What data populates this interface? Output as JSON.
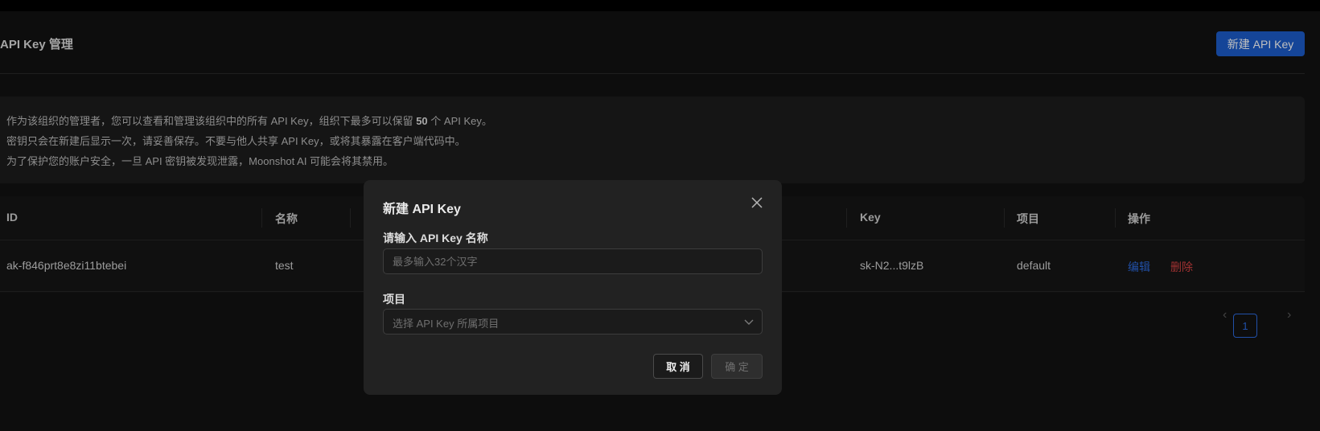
{
  "page": {
    "title": "API Key 管理",
    "new_button": "新建 API Key"
  },
  "notice": {
    "line1_pre": "作为该组织的管理者，您可以查看和管理该组织中的所有 API Key，组织下最多可以保留 ",
    "line1_count": "50",
    "line1_post": " 个 API Key。",
    "line2": "密钥只会在新建后显示一次，请妥善保存。不要与他人共享 API Key，或将其暴露在客户端代码中。",
    "line3": "为了保护您的账户安全，一旦 API 密钥被发现泄露，Moonshot AI 可能会将其禁用。"
  },
  "table": {
    "headers": {
      "id": "ID",
      "name": "名称",
      "key": "Key",
      "project": "项目",
      "actions": "操作"
    },
    "rows": [
      {
        "id": "ak-f846prt8e8zi11btebei",
        "name": "test",
        "key": "sk-N2...t9lzB",
        "project": "default",
        "edit": "编辑",
        "delete": "删除"
      }
    ]
  },
  "pagination": {
    "current_page": "1",
    "prev": "‹",
    "next": "›"
  },
  "modal": {
    "title": "新建 API Key",
    "name_label": "请输入 API Key 名称",
    "name_placeholder": "最多输入32个汉字",
    "project_label": "项目",
    "project_placeholder": "选择 API Key 所属项目",
    "cancel": "取 消",
    "ok": "确 定"
  },
  "colors": {
    "accent": "#1d5dcb",
    "link": "#2d6be0",
    "danger": "#d64242",
    "background": "#121212"
  },
  "icons": {
    "close": "close-icon",
    "select_arrow": "chevron-down-icon",
    "prev": "chevron-left-icon",
    "next": "chevron-right-icon"
  }
}
